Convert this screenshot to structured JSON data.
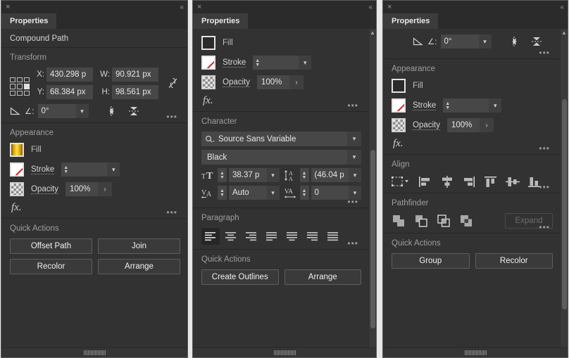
{
  "theme": {
    "panel_bg": "#323232",
    "titlebar_bg": "#2b2b2b",
    "tab_active_bg": "#3c3c3c",
    "field_bg": "#474747",
    "text": "#e6e6e6",
    "label": "#9e9e9e",
    "accent_gradient_fill": "#ffe14a",
    "none_slash": "#e01b1b"
  },
  "panels": [
    {
      "id": "panel-1",
      "titlebar": {
        "close_label": "×",
        "collapse_label": "«"
      },
      "tab": {
        "label": "Properties"
      },
      "object_type": "Compound Path",
      "transform": {
        "title": "Transform",
        "x_label": "X:",
        "x_value": "430.298 p",
        "y_label": "Y:",
        "y_value": "68.384 px",
        "w_label": "W:",
        "w_value": "90.921 px",
        "h_label": "H:",
        "h_value": "98.561 px",
        "angle_label": "∠:",
        "angle_value": "0°",
        "link_state": "unlinked",
        "flip_horizontal": "flip-horizontal",
        "flip_vertical": "flip-vertical",
        "more_options": "•••"
      },
      "appearance": {
        "title": "Appearance",
        "fill_label": "Fill",
        "fill_swatch": "gradient-gold",
        "stroke_label": "Stroke",
        "stroke_swatch": "none",
        "stroke_weight_value": "",
        "opacity_label": "Opacity",
        "opacity_swatch": "checkerboard",
        "opacity_value": "100%",
        "fx_label": "fx.",
        "more_options": "•••"
      },
      "quick_actions": {
        "title": "Quick Actions",
        "buttons": [
          "Offset Path",
          "Join",
          "Recolor",
          "Arrange"
        ]
      }
    },
    {
      "id": "panel-2",
      "titlebar": {
        "close_label": "×",
        "collapse_label": "«"
      },
      "tab": {
        "label": "Properties"
      },
      "appearance": {
        "fill_label": "Fill",
        "fill_swatch": "black",
        "stroke_label": "Stroke",
        "stroke_swatch": "none",
        "stroke_weight_value": "",
        "opacity_label": "Opacity",
        "opacity_swatch": "checkerboard",
        "opacity_value": "100%",
        "fx_label": "fx.",
        "more_options": "•••"
      },
      "character": {
        "title": "Character",
        "font_family": "Source Sans Variable",
        "font_style": "Black",
        "font_size_value": "38.37 p",
        "leading_value": "(46.04 p",
        "kerning_value": "Auto",
        "tracking_value": "0",
        "more_options": "•••"
      },
      "paragraph": {
        "title": "Paragraph",
        "buttons": [
          "align-left",
          "align-center",
          "align-right",
          "justify-last-left",
          "justify-last-center",
          "justify-last-right",
          "justify-all"
        ],
        "selected_index": 0,
        "more_options": "•••"
      },
      "quick_actions": {
        "title": "Quick Actions",
        "buttons": [
          "Create Outlines",
          "Arrange"
        ]
      },
      "scrollbar": {
        "thumb_top_pct": 38,
        "thumb_height_pct": 56
      }
    },
    {
      "id": "panel-3",
      "titlebar": {
        "close_label": "×",
        "collapse_label": "«"
      },
      "tab": {
        "label": "Properties"
      },
      "transform_partial": {
        "angle_label": "∠:",
        "angle_value": "0°",
        "flip_horizontal": "flip-horizontal",
        "flip_vertical": "flip-vertical",
        "more_options": "•••"
      },
      "appearance": {
        "title": "Appearance",
        "fill_label": "Fill",
        "fill_swatch": "black",
        "stroke_label": "Stroke",
        "stroke_swatch": "none",
        "stroke_weight_value": "",
        "opacity_label": "Opacity",
        "opacity_swatch": "checkerboard",
        "opacity_value": "100%",
        "fx_label": "fx.",
        "more_options": "•••"
      },
      "align": {
        "title": "Align",
        "align_to": "align-to-selection",
        "buttons": [
          "align-left-edges",
          "align-horizontal-centers",
          "align-right-edges",
          "align-top-edges",
          "align-vertical-centers",
          "align-bottom-edges"
        ],
        "more_options": "•••"
      },
      "pathfinder": {
        "title": "Pathfinder",
        "buttons": [
          "unite",
          "minus-front",
          "intersect",
          "exclude"
        ],
        "expand_label": "Expand",
        "expand_enabled": false,
        "more_options": "•••"
      },
      "quick_actions": {
        "title": "Quick Actions",
        "buttons": [
          "Group",
          "Recolor"
        ]
      },
      "scrollbar": {
        "thumb_top_pct": 22,
        "thumb_height_pct": 66
      }
    }
  ]
}
